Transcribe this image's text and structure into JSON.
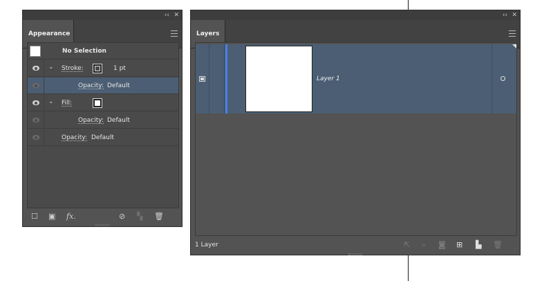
{
  "appearance": {
    "tab_label": "Appearance",
    "collapse_glyph": "‹‹",
    "close_glyph": "✕",
    "selection_label": "No Selection",
    "stroke": {
      "label": "Stroke:",
      "weight": "1 pt"
    },
    "stroke_opacity": {
      "label": "Opacity:",
      "value": "Default"
    },
    "fill": {
      "label": "Fill:"
    },
    "fill_opacity": {
      "label": "Opacity:",
      "value": "Default"
    },
    "object_opacity": {
      "label": "Opacity:",
      "value": "Default"
    },
    "footer_fx": "fx."
  },
  "layers": {
    "tab_label": "Layers",
    "collapse_glyph": "‹‹",
    "close_glyph": "✕",
    "layer_name": "Layer 1",
    "layer_color": "#4c7ee6",
    "footer_count": "1 Layer"
  },
  "colors": {
    "panel_bg": "#535353",
    "selection_bg": "#4b5e73"
  }
}
